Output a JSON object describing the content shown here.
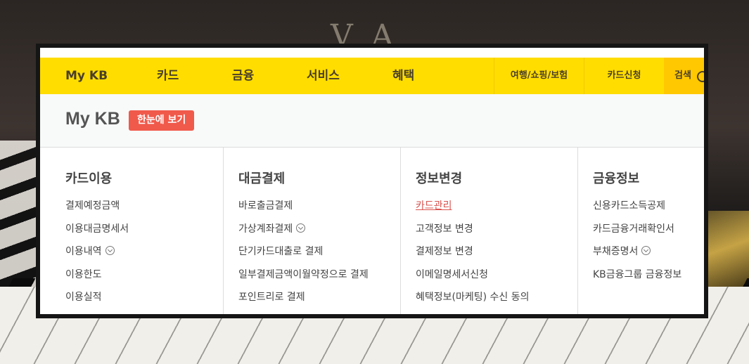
{
  "gnb": {
    "menus": [
      "My KB",
      "카드",
      "금융",
      "서비스",
      "혜택"
    ],
    "utils": [
      "여행/쇼핑/보험",
      "카드신청"
    ],
    "search_label": "검색"
  },
  "submenu": {
    "title": "My KB",
    "badge": "한눈에 보기",
    "columns": [
      {
        "title": "카드이용",
        "items": [
          "결제예정금액",
          "이용대금명세서",
          "이용내역",
          "이용한도",
          "이용실적"
        ]
      },
      {
        "title": "대금결제",
        "items": [
          "바로출금결제",
          "가상계좌결제",
          "단기카드대출로 결제",
          "일부결제금액이월약정으로 결제",
          "포인트리로 결제"
        ]
      },
      {
        "title": "정보변경",
        "items": [
          "카드관리",
          "고객정보 변경",
          "결제정보 변경",
          "이메일명세서신청",
          "혜택정보(마케팅) 수신 동의"
        ]
      },
      {
        "title": "금융정보",
        "items": [
          "신용카드소득공제",
          "카드금융거래확인서",
          "부채증명서",
          "KB금융그룹 금융정보"
        ]
      }
    ]
  },
  "colors": {
    "accent": "#ffdd00",
    "badge": "#f05a4b",
    "active_link": "#d9534f"
  }
}
